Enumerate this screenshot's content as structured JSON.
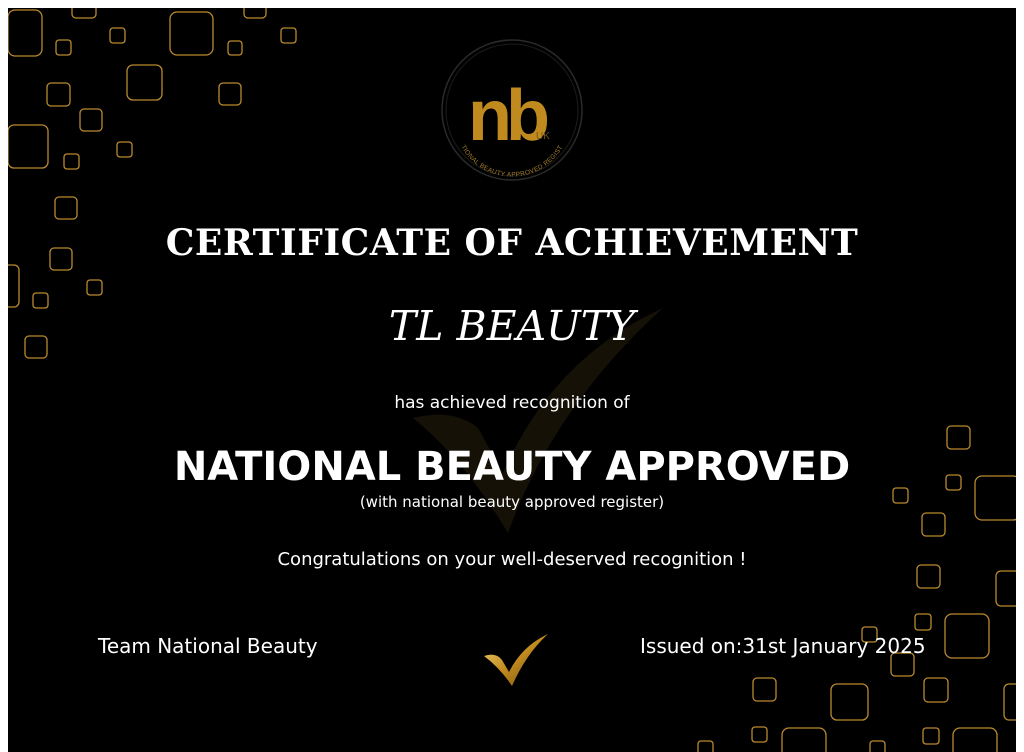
{
  "certificate": {
    "title": "CERTIFICATE OF ACHIEVEMENT",
    "recipient": "TL BEAUTY",
    "recognition_line": "has achieved recognition of",
    "award": "NATIONAL BEAUTY APPROVED",
    "award_subtitle": "(with national beauty approved register)",
    "congratulations": "Congratulations on your well-deserved recognition !",
    "signature": "Team National Beauty",
    "issued": "Issued on:31st January 2025"
  },
  "logo": {
    "letters": "nb",
    "suffix": "UK",
    "ring_text": "NATIONAL BEAUTY APPROVED REGISTER",
    "icon": "nba-logo-icon"
  },
  "icons": {
    "checkmark": "gold-checkmark-icon",
    "watermark": "checkmark-watermark-icon"
  },
  "colors": {
    "background": "#000000",
    "accent_gold": "#b98a2e",
    "text": "#ffffff"
  }
}
